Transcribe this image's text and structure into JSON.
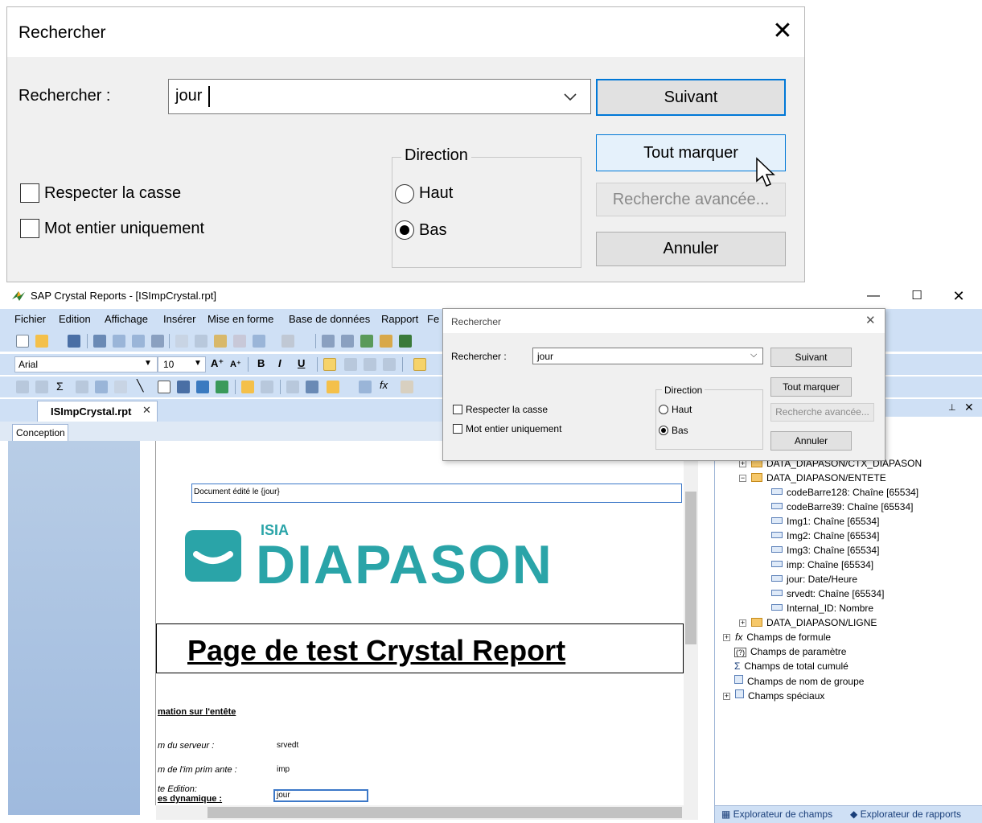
{
  "zoom_dialog": {
    "title": "Rechercher",
    "search_label": "Rechercher :",
    "search_value": "jour",
    "case_label": "Respecter la casse",
    "whole_word_label": "Mot entier uniquement",
    "direction_label": "Direction",
    "up_label": "Haut",
    "down_label": "Bas",
    "selected_direction": "Bas",
    "next_button": "Suivant",
    "mark_all_button": "Tout marquer",
    "advanced_button": "Recherche avancée...",
    "cancel_button": "Annuler"
  },
  "app": {
    "title": "SAP Crystal Reports - [ISImpCrystal.rpt]",
    "menu": [
      "Fichier",
      "Edition",
      "Affichage",
      "Insérer",
      "Mise en forme",
      "Base de données",
      "Rapport",
      "Fe"
    ],
    "font_name": "Arial",
    "font_size": "10",
    "doc_tab": "ISImpCrystal.rpt",
    "view_tab": "Conception"
  },
  "report": {
    "doc_field": "Document édité le {jour}",
    "logo_small": "ISIA",
    "logo_big": "DIAPASON",
    "page_title": "Page de test Crystal Report",
    "section_header": "mation sur l'entête",
    "server_label": "m  du serveur :",
    "server_field": "srvedt",
    "printer_label": "m  de l'im prim ante :",
    "printer_field": "imp",
    "edition_label": "te Edition:",
    "jour_field": "jour",
    "dynamic_label": "es dynamique :"
  },
  "panel": {
    "tree": [
      {
        "label": "DATA_DIAPASON/CTX_DIAPASON",
        "kind": "table",
        "expander": "+"
      },
      {
        "label": "DATA_DIAPASON/ENTETE",
        "kind": "table",
        "expander": "-"
      },
      {
        "label": "codeBarre128: Chaîne [65534]",
        "kind": "field"
      },
      {
        "label": "codeBarre39: Chaîne [65534]",
        "kind": "field"
      },
      {
        "label": "Img1: Chaîne [65534]",
        "kind": "field"
      },
      {
        "label": "Img2: Chaîne [65534]",
        "kind": "field"
      },
      {
        "label": "Img3: Chaîne [65534]",
        "kind": "field"
      },
      {
        "label": "imp: Chaîne [65534]",
        "kind": "field"
      },
      {
        "label": "jour: Date/Heure",
        "kind": "field"
      },
      {
        "label": "srvedt: Chaîne [65534]",
        "kind": "field"
      },
      {
        "label": "Internal_ID: Nombre",
        "kind": "field"
      },
      {
        "label": "DATA_DIAPASON/LIGNE",
        "kind": "table",
        "expander": "+"
      },
      {
        "label": "Champs de formule",
        "kind": "formula",
        "expander": "+"
      },
      {
        "label": "Champs de paramètre",
        "kind": "param"
      },
      {
        "label": "Champs de total cumulé",
        "kind": "total"
      },
      {
        "label": "Champs de nom de groupe",
        "kind": "group"
      },
      {
        "label": "Champs spéciaux",
        "kind": "special",
        "expander": "+"
      }
    ],
    "footer_tab1": "Explorateur de champs",
    "footer_tab2": "Explorateur de rapports"
  },
  "small_dialog": {
    "title": "Rechercher",
    "search_label": "Rechercher :",
    "search_value": "jour",
    "case_label": "Respecter la casse",
    "whole_word_label": "Mot entier uniquement",
    "direction_label": "Direction",
    "up_label": "Haut",
    "down_label": "Bas",
    "next_button": "Suivant",
    "mark_all_button": "Tout marquer",
    "advanced_button": "Recherche avancée...",
    "cancel_button": "Annuler"
  },
  "colors": {
    "accent": "#0078d7",
    "chrome": "#cfe0f5",
    "brand_teal": "#2aa4a8"
  }
}
